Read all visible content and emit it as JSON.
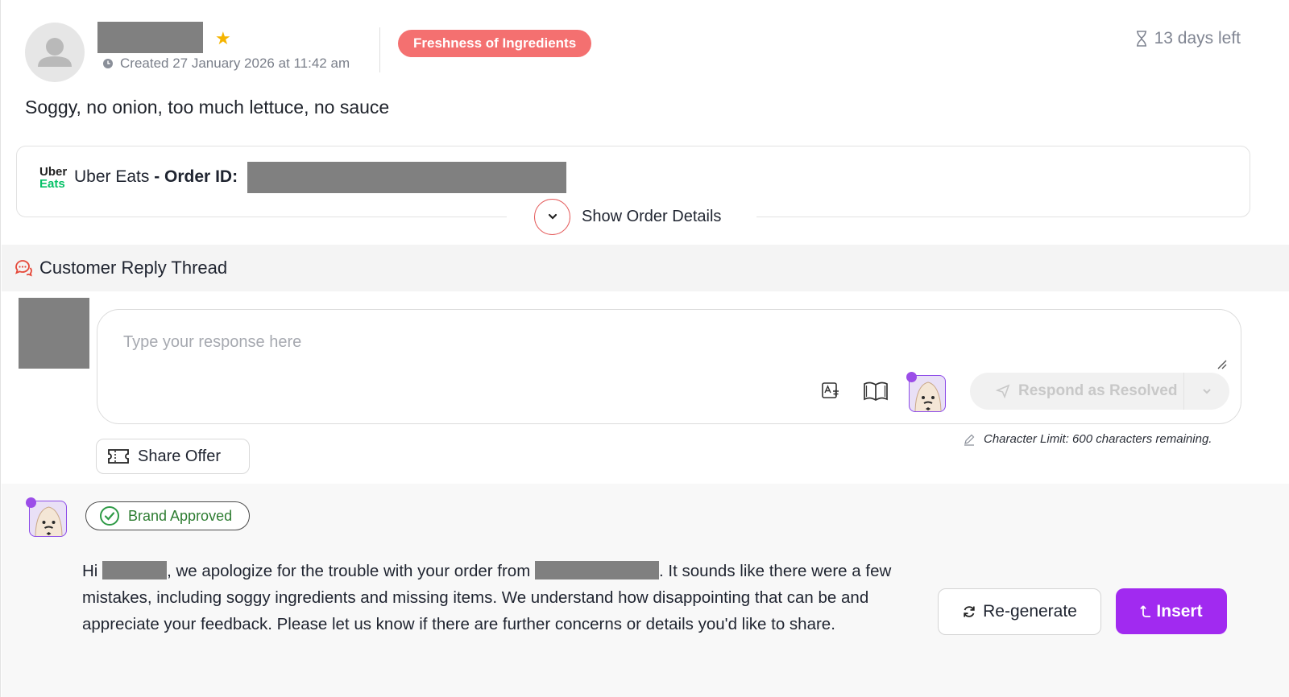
{
  "review": {
    "created": "Created 27 January 2026 at 11:42 am",
    "tag": "Freshness of Ingredients",
    "time_left": "13 days left",
    "text": "Soggy, no onion, too much lettuce, no sauce"
  },
  "order": {
    "platform_logo_top": "Uber",
    "platform_logo_bottom": "Eats",
    "platform": "Uber Eats",
    "order_id_label": "- Order ID:",
    "show_details": "Show Order Details"
  },
  "thread": {
    "title": "Customer Reply Thread",
    "placeholder": "Type your response here",
    "respond_button": "Respond as Resolved",
    "char_limit": "Character Limit: 600 characters remaining.",
    "share_offer": "Share Offer"
  },
  "suggestion": {
    "badge": "Brand Approved",
    "text_hi": "Hi",
    "text_part1": ", we apologize for the trouble with your order from",
    "text_part2": ". It sounds like there were a few mistakes, including soggy ingredients and missing items. We understand how disappointing that can be and appreciate your feedback. Please let us know if there are further concerns or details you'd like to share.",
    "regenerate": "Re-generate",
    "insert": "Insert"
  },
  "colors": {
    "tag_bg": "#f47070",
    "accent_purple": "#a12af0",
    "approved_green": "#2e7d32",
    "star": "#f5b400",
    "uber_green": "#06c167"
  },
  "icons": [
    "user-avatar-icon",
    "star-icon",
    "clock-icon",
    "hourglass-icon",
    "chevron-down-icon",
    "chat-bubbles-icon",
    "translate-icon",
    "book-icon",
    "bot-avatar-icon",
    "send-icon",
    "caret-down-icon",
    "pencil-icon",
    "ticket-icon",
    "check-circle-icon",
    "refresh-icon",
    "insert-arrow-icon"
  ]
}
